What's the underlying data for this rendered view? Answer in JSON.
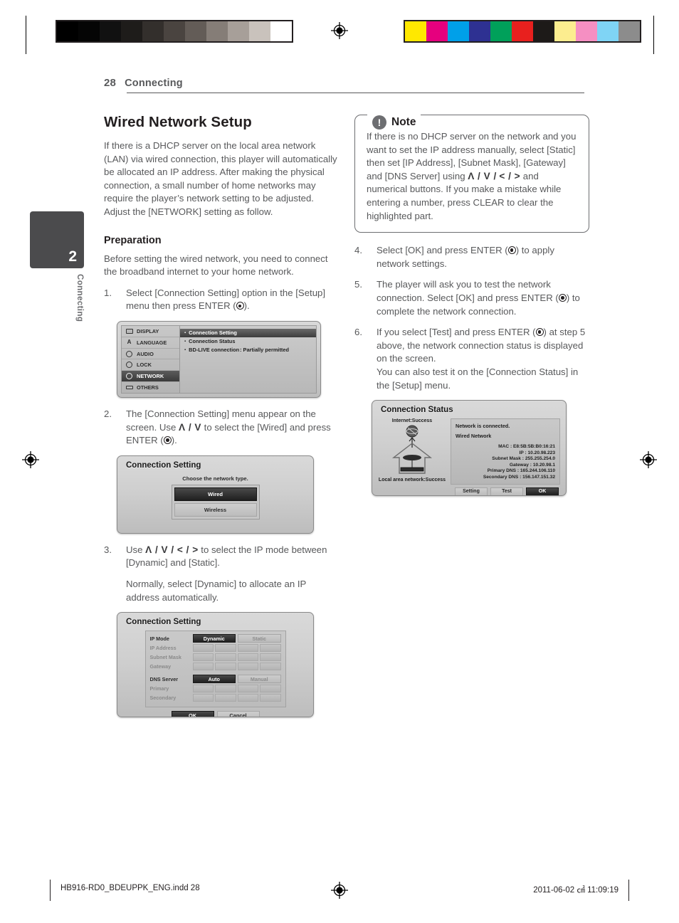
{
  "header": {
    "page_number": "28",
    "section": "Connecting"
  },
  "chapter_tab": {
    "number": "2",
    "label": "Connecting"
  },
  "left_column": {
    "section_title": "Wired Network Setup",
    "intro": "If there is a DHCP server on the local area network (LAN) via wired connection, this player will automatically be allocated an IP address. After making the physical connection, a small number of home networks may require the player’s network setting to be adjusted. Adjust the [NETWORK] setting as follow.",
    "sub_title": "Preparation",
    "prep_text": "Before setting the wired network, you need to connect the broadband internet to your home network.",
    "step1_num": "1.",
    "step1_a": "Select [Connection Setting] option in the [Setup] menu then press ENTER (",
    "step1_b": ").",
    "step2_num": "2.",
    "step2_a": "The [Connection Setting] menu appear on the screen. Use ",
    "step2_nav": "Λ / V",
    "step2_b": " to select the [Wired] and press ENTER (",
    "step2_c": ").",
    "step3_num": "3.",
    "step3_a": "Use ",
    "step3_nav": "Λ / V / < / >",
    "step3_b": " to select the IP mode between [Dynamic] and [Static].",
    "step3_c": "Normally, select [Dynamic] to allocate an IP address automatically."
  },
  "note": {
    "title": "Note",
    "icon": "exclamation-icon",
    "text_a": "If there is no DHCP server on the network and you want to set the IP address manually, select [Static] then set [IP Address], [Subnet Mask], [Gateway] and [DNS Server] using ",
    "nav_a": "Λ / V /",
    "nav_b": "< / >",
    "text_b": " and numerical buttons. If you make a mistake while entering a number, press CLEAR to clear the highlighted part."
  },
  "right_column": {
    "step4_num": "4.",
    "step4_a": "Select [OK] and press ENTER (",
    "step4_b": ") to apply network settings.",
    "step5_num": "5.",
    "step5_a": "The player will ask you to test the network connection. Select [OK] and press ENTER (",
    "step5_b": ") to complete the network connection.",
    "step6_num": "6.",
    "step6_a": "If you select [Test] and press ENTER (",
    "step6_b": ") at step 5 above, the network connection status is displayed on the screen.",
    "step6_c": "You can also test it on the [Connection Status] in the [Setup] menu."
  },
  "osd_setup_menu": {
    "sidebar": [
      {
        "label": "DISPLAY",
        "icon": "monitor-icon",
        "active": false
      },
      {
        "label": "LANGUAGE",
        "icon": "letter-a-icon",
        "active": false
      },
      {
        "label": "AUDIO",
        "icon": "speaker-icon",
        "active": false
      },
      {
        "label": "LOCK",
        "icon": "lock-icon",
        "active": false
      },
      {
        "label": "NETWORK",
        "icon": "globe-icon",
        "active": true
      },
      {
        "label": "OTHERS",
        "icon": "others-icon",
        "active": false
      }
    ],
    "options": [
      {
        "label": "Connection Setting",
        "value": "",
        "selected": true
      },
      {
        "label": "Connection Status",
        "value": "",
        "selected": false
      },
      {
        "label": "BD-LIVE connection",
        "value": ": Partially permitted",
        "selected": false
      }
    ]
  },
  "osd_network_type": {
    "title": "Connection Setting",
    "prompt": "Choose the network type.",
    "buttons": [
      {
        "label": "Wired",
        "selected": true
      },
      {
        "label": "Wireless",
        "selected": false
      }
    ]
  },
  "osd_ip_mode": {
    "title": "Connection Setting",
    "ip_mode_label": "IP Mode",
    "ip_mode_options": [
      {
        "label": "Dynamic",
        "selected": true
      },
      {
        "label": "Static",
        "selected": false
      }
    ],
    "fields": [
      "IP Address",
      "Subnet Mask",
      "Gateway"
    ],
    "dns_label": "DNS Server",
    "dns_options": [
      {
        "label": "Auto",
        "selected": true
      },
      {
        "label": "Manual",
        "selected": false
      }
    ],
    "dns_fields": [
      "Primary",
      "Secondary"
    ],
    "actions": [
      {
        "label": "OK",
        "selected": true
      },
      {
        "label": "Cancel",
        "selected": false
      }
    ]
  },
  "osd_connection_status": {
    "title": "Connection Status",
    "internet_label": "Internet:Success",
    "lan_label": "Local area network:Success",
    "message": "Network is connected.",
    "network_type": "Wired Network",
    "details": [
      "MAC : E8:5B:5B:B0:16:21",
      "IP : 10.20.98.223",
      "Subnet Mask : 255.255.254.0",
      "Gateway : 10.20.98.1",
      "Primary DNS : 165.244.106.110",
      "Secondary DNS : 156.147.151.32"
    ],
    "actions": [
      {
        "label": "Setting",
        "selected": false
      },
      {
        "label": "Test",
        "selected": false
      },
      {
        "label": "OK",
        "selected": true
      }
    ]
  },
  "footer": {
    "filename": "HB916-RD0_BDEUPPK_ENG.indd   28",
    "timestamp": "2011-06-02   ㎠ 11:09:19"
  },
  "calibration": {
    "grayscale": [
      "#000000",
      "#050505",
      "#111111",
      "#1e1c1a",
      "#332f2c",
      "#4a4440",
      "#635c57",
      "#857d77",
      "#a79f99",
      "#c9c2bc",
      "#ffffff"
    ],
    "colors": [
      "#ffe800",
      "#e6007e",
      "#00a0e9",
      "#2e3192",
      "#00a05a",
      "#e8201e",
      "#1d1a18",
      "#fced8f",
      "#f58fc2",
      "#7fd4f5",
      "#8c8c8c"
    ]
  }
}
